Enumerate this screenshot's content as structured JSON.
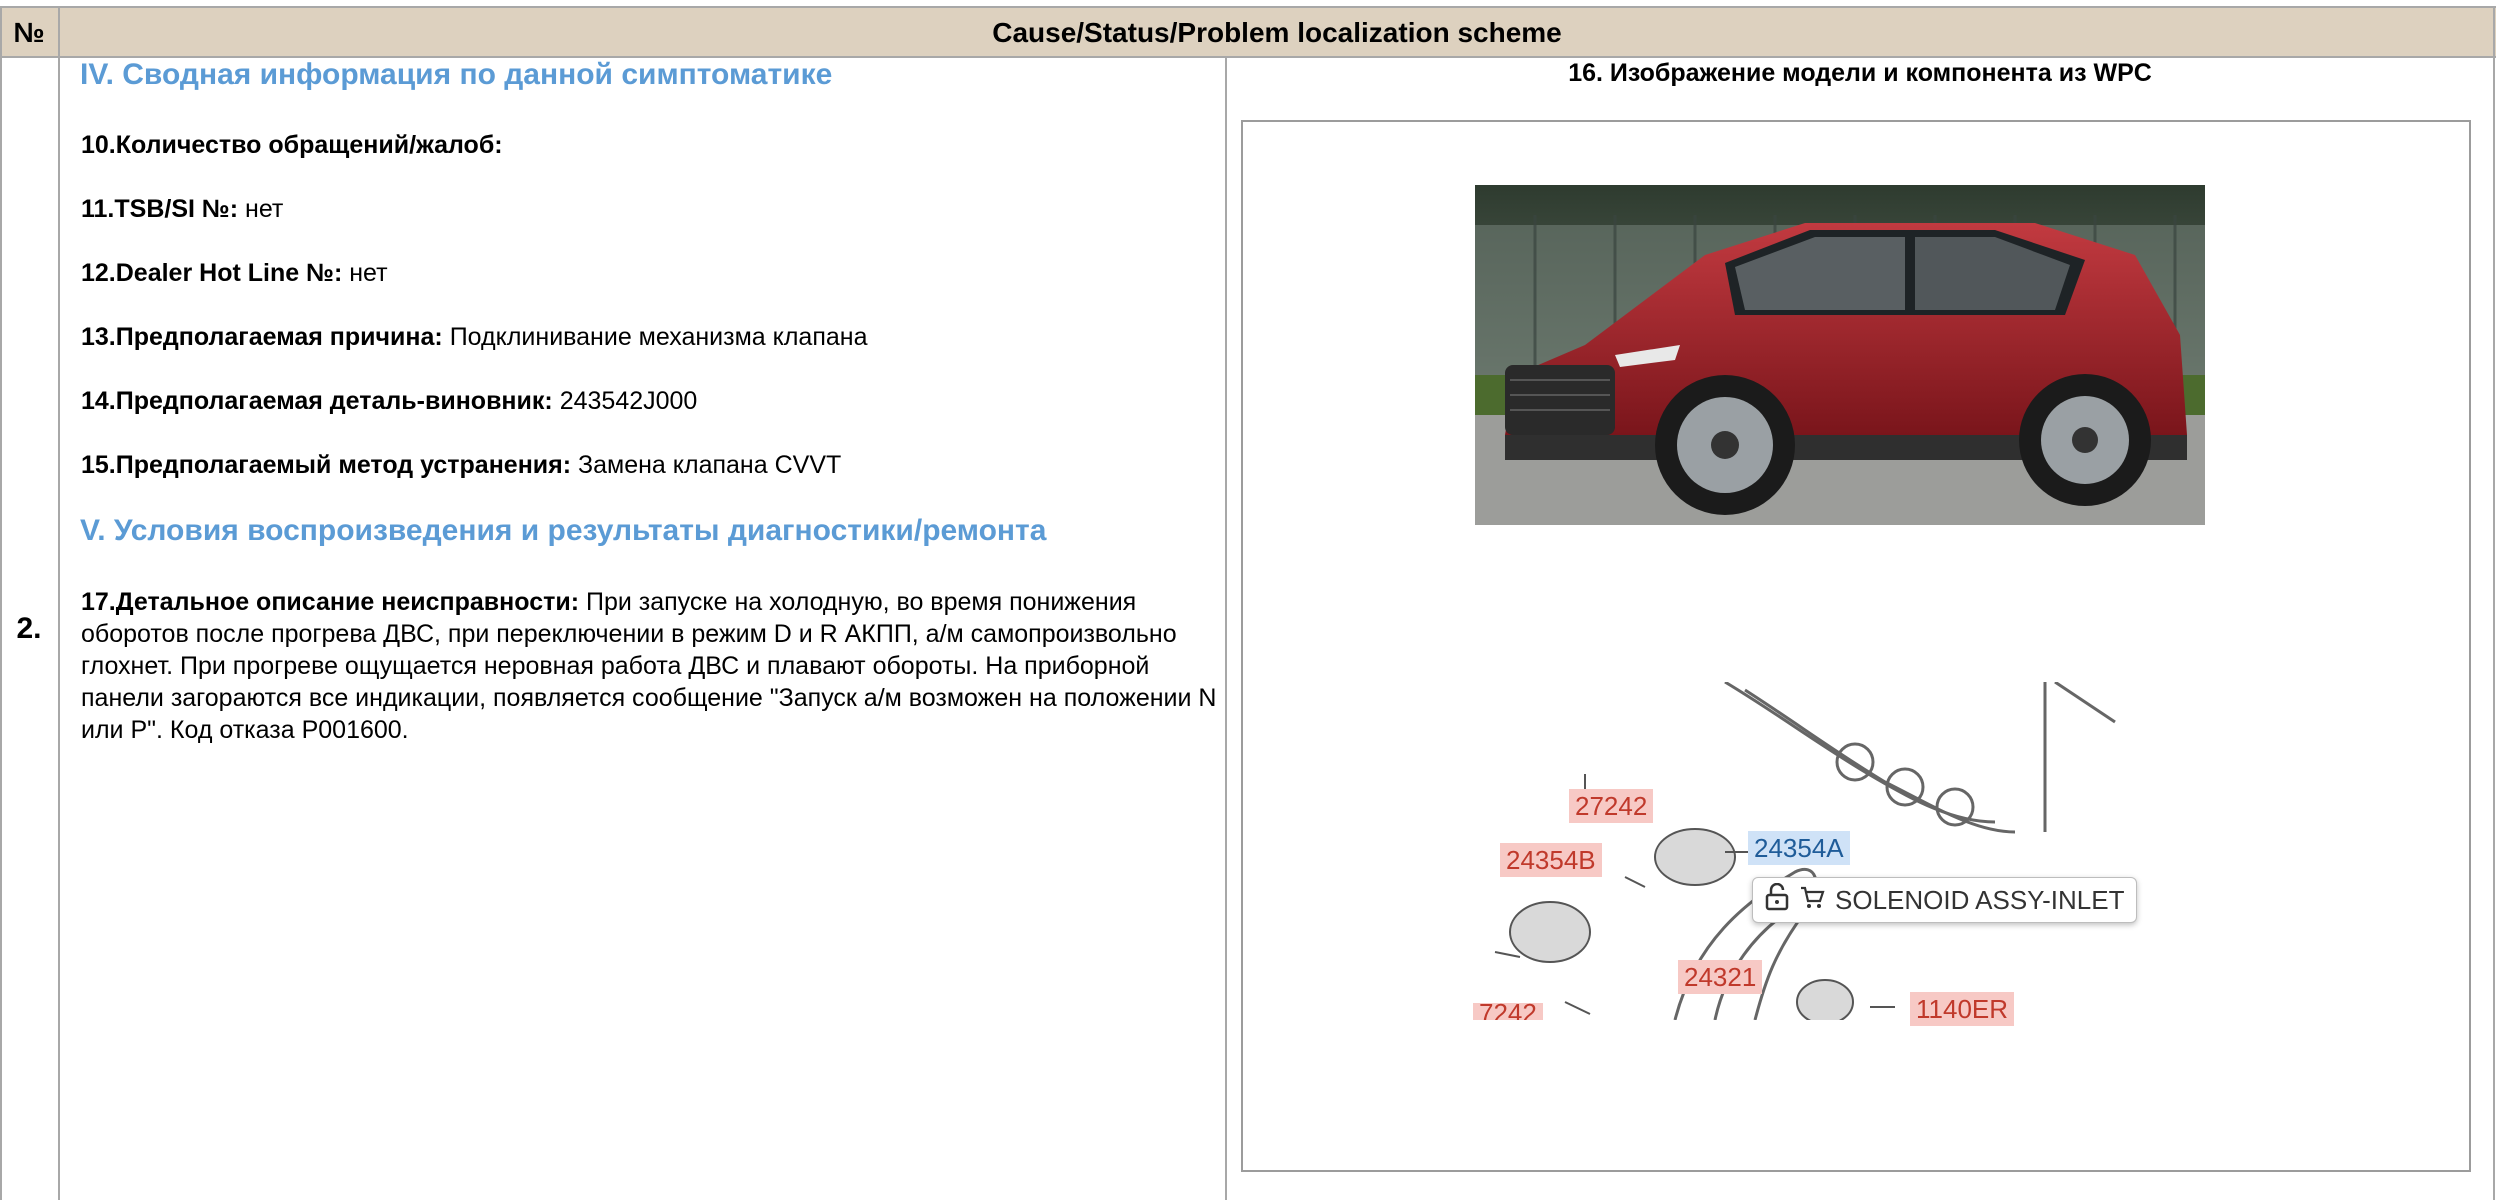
{
  "header": {
    "num_col": "№",
    "title": "Cause/Status/Problem localization scheme"
  },
  "row": {
    "number": "2.",
    "left": {
      "section4_title": "IV. Сводная информация по данной симптоматике",
      "fields": [
        {
          "label": "10.Количество обращений/жалоб:",
          "value": ""
        },
        {
          "label": "11.TSB/SI №:",
          "value": "нет"
        },
        {
          "label": "12.Dealer Hot Line №:",
          "value": "нет"
        },
        {
          "label": "13.Предполагаемая причина:",
          "value": "Подклинивание механизма клапана"
        },
        {
          "label": "14.Предполагаемая деталь-виновник:",
          "value": "243542J000"
        },
        {
          "label": "15.Предполагаемый метод устранения:",
          "value": "Замена клапана CVVT"
        }
      ],
      "section5_title": "V. Условия воспроизведения и результаты диагностики/ремонта",
      "description": {
        "label": "17.Детальное описание неисправности:",
        "text": "При запуске на холодную, во время понижения оборотов после прогрева ДВС, при переключении в режим D и R АКПП, а/м самопроизвольно глохнет. При прогреве ощущается неровная работа ДВС и плавают обороты. На приборной панели загораются все индикации, появляется сообщение \"Запуск а/м возможен на положении N или P\". Код отказа P001600."
      }
    },
    "right": {
      "title": "16. Изображение модели и компонента из WPC",
      "diagram": {
        "labels": [
          "27242",
          "24354B",
          "24354A",
          "24321",
          "1140ER",
          "7242"
        ],
        "tooltip": "SOLENOID ASSY-INLET",
        "icons": [
          "unlock-icon",
          "cart-icon"
        ]
      }
    }
  },
  "colors": {
    "header_bg": "#ddd1bf",
    "section": "#5b9bd5",
    "car_red": "#a8242c",
    "label_red": "#f7c9c5",
    "label_blue": "#cfe2f7"
  }
}
